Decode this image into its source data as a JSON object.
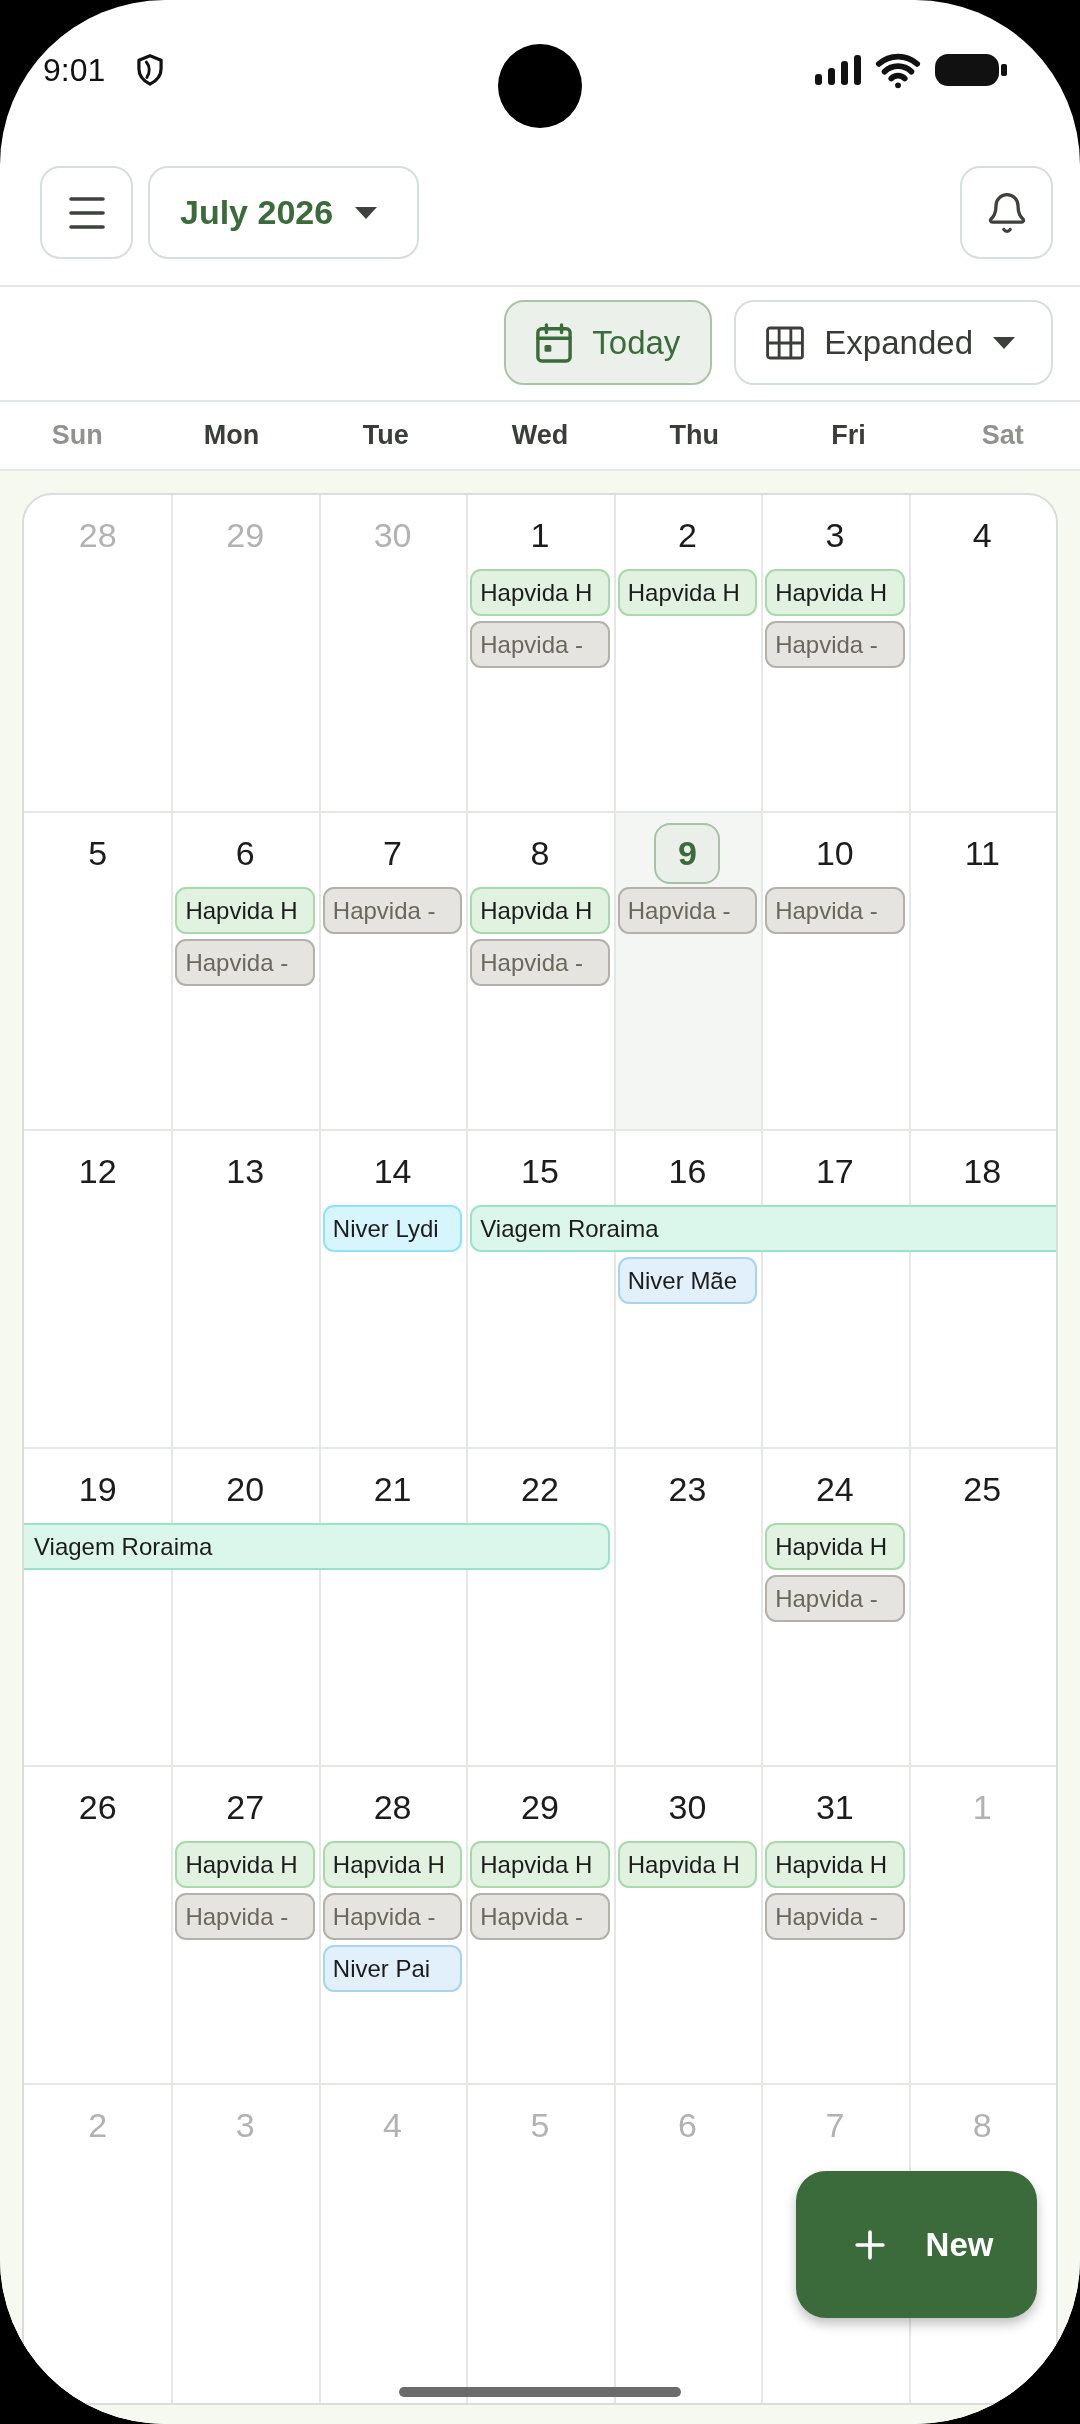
{
  "status_bar": {
    "time": "9:01"
  },
  "top_bar": {
    "month_button": {
      "label": "July 2026"
    }
  },
  "view_bar": {
    "today_button": {
      "label": "Today"
    },
    "view_select": {
      "label": "Expanded"
    }
  },
  "weekdays": [
    {
      "label": "Sun",
      "weekend": true
    },
    {
      "label": "Mon",
      "weekend": false
    },
    {
      "label": "Tue",
      "weekend": false
    },
    {
      "label": "Wed",
      "weekend": false
    },
    {
      "label": "Thu",
      "weekend": false
    },
    {
      "label": "Fri",
      "weekend": false
    },
    {
      "label": "Sat",
      "weekend": true
    }
  ],
  "weeks": [
    {
      "days": [
        {
          "label": "28",
          "in_month": false,
          "today": false
        },
        {
          "label": "29",
          "in_month": false,
          "today": false
        },
        {
          "label": "30",
          "in_month": false,
          "today": false
        },
        {
          "label": "1",
          "in_month": true,
          "today": false,
          "events": [
            {
              "kind": "single",
              "title": "Hapvida H",
              "color": "#a8d9aa"
            },
            {
              "kind": "single",
              "title": "Hapvida -",
              "color": "#b4b1aa"
            }
          ]
        },
        {
          "label": "2",
          "in_month": true,
          "today": false,
          "events": [
            {
              "kind": "single",
              "title": "Hapvida H",
              "color": "#a8d9aa"
            }
          ]
        },
        {
          "label": "3",
          "in_month": true,
          "today": false,
          "events": [
            {
              "kind": "single",
              "title": "Hapvida H",
              "color": "#a8d9aa"
            },
            {
              "kind": "single",
              "title": "Hapvida -",
              "color": "#b4b1aa"
            }
          ]
        },
        {
          "label": "4",
          "in_month": true,
          "today": false
        }
      ]
    },
    {
      "days": [
        {
          "label": "5",
          "in_month": true,
          "today": false
        },
        {
          "label": "6",
          "in_month": true,
          "today": false,
          "events": [
            {
              "kind": "single",
              "title": "Hapvida H",
              "color": "#a8d9aa"
            },
            {
              "kind": "single",
              "title": "Hapvida -",
              "color": "#b4b1aa"
            }
          ]
        },
        {
          "label": "7",
          "in_month": true,
          "today": false,
          "events": [
            {
              "kind": "single",
              "title": "Hapvida -",
              "color": "#b4b1aa"
            }
          ]
        },
        {
          "label": "8",
          "in_month": true,
          "today": false,
          "events": [
            {
              "kind": "single",
              "title": "Hapvida H",
              "color": "#a8d9aa"
            },
            {
              "kind": "single",
              "title": "Hapvida -",
              "color": "#b4b1aa"
            }
          ]
        },
        {
          "label": "9",
          "in_month": true,
          "today": true,
          "events": [
            {
              "kind": "single",
              "title": "Hapvida -",
              "color": "#b4b1aa"
            }
          ]
        },
        {
          "label": "10",
          "in_month": true,
          "today": false,
          "events": [
            {
              "kind": "single",
              "title": "Hapvida -",
              "color": "#b4b1aa"
            }
          ]
        },
        {
          "label": "11",
          "in_month": true,
          "today": false
        }
      ]
    },
    {
      "days": [
        {
          "label": "12",
          "in_month": true,
          "today": false
        },
        {
          "label": "13",
          "in_month": true,
          "today": false
        },
        {
          "label": "14",
          "in_month": true,
          "today": false,
          "events": [
            {
              "kind": "single",
              "title": "Niver Lydi",
              "color": "#8ee3fa"
            }
          ]
        },
        {
          "label": "15",
          "in_month": true,
          "today": false,
          "events": [
            {
              "kind": "start",
              "title": "Viagem Roraima",
              "color": "#99e4c6"
            }
          ]
        },
        {
          "label": "16",
          "in_month": true,
          "today": false,
          "events": [
            {
              "kind": "through"
            },
            {
              "kind": "single",
              "title": "Niver Mãe",
              "color": "#a8d4f0"
            }
          ]
        },
        {
          "label": "17",
          "in_month": true,
          "today": false,
          "events": [
            {
              "kind": "through"
            }
          ]
        },
        {
          "label": "18",
          "in_month": true,
          "today": false,
          "events": [
            {
              "kind": "through"
            }
          ]
        }
      ]
    },
    {
      "days": [
        {
          "label": "19",
          "in_month": true,
          "today": false,
          "events": [
            {
              "kind": "carry",
              "title": "Viagem Roraima",
              "color": "#99e4c6"
            }
          ]
        },
        {
          "label": "20",
          "in_month": true,
          "today": false,
          "events": [
            {
              "kind": "through"
            }
          ]
        },
        {
          "label": "21",
          "in_month": true,
          "today": false,
          "events": [
            {
              "kind": "through"
            }
          ]
        },
        {
          "label": "22",
          "in_month": true,
          "today": false,
          "events": [
            {
              "kind": "end"
            }
          ]
        },
        {
          "label": "23",
          "in_month": true,
          "today": false
        },
        {
          "label": "24",
          "in_month": true,
          "today": false,
          "events": [
            {
              "kind": "single",
              "title": "Hapvida H",
              "color": "#a8d9aa"
            },
            {
              "kind": "single",
              "title": "Hapvida -",
              "color": "#b4b1aa"
            }
          ]
        },
        {
          "label": "25",
          "in_month": true,
          "today": false
        }
      ]
    },
    {
      "days": [
        {
          "label": "26",
          "in_month": true,
          "today": false
        },
        {
          "label": "27",
          "in_month": true,
          "today": false,
          "events": [
            {
              "kind": "single",
              "title": "Hapvida H",
              "color": "#a8d9aa"
            },
            {
              "kind": "single",
              "title": "Hapvida -",
              "color": "#b4b1aa"
            }
          ]
        },
        {
          "label": "28",
          "in_month": true,
          "today": false,
          "events": [
            {
              "kind": "single",
              "title": "Hapvida H",
              "color": "#a8d9aa"
            },
            {
              "kind": "single",
              "title": "Hapvida -",
              "color": "#b4b1aa"
            },
            {
              "kind": "single",
              "title": "Niver Pai",
              "color": "#a8d4f0"
            }
          ]
        },
        {
          "label": "29",
          "in_month": true,
          "today": false,
          "events": [
            {
              "kind": "single",
              "title": "Hapvida H",
              "color": "#a8d9aa"
            },
            {
              "kind": "single",
              "title": "Hapvida -",
              "color": "#b4b1aa"
            }
          ]
        },
        {
          "label": "30",
          "in_month": true,
          "today": false,
          "events": [
            {
              "kind": "single",
              "title": "Hapvida H",
              "color": "#a8d9aa"
            }
          ]
        },
        {
          "label": "31",
          "in_month": true,
          "today": false,
          "events": [
            {
              "kind": "single",
              "title": "Hapvida H",
              "color": "#a8d9aa"
            },
            {
              "kind": "single",
              "title": "Hapvida -",
              "color": "#b4b1aa"
            }
          ]
        },
        {
          "label": "1",
          "in_month": false,
          "today": false
        }
      ]
    },
    {
      "days": [
        {
          "label": "2",
          "in_month": false,
          "today": false
        },
        {
          "label": "3",
          "in_month": false,
          "today": false
        },
        {
          "label": "4",
          "in_month": false,
          "today": false
        },
        {
          "label": "5",
          "in_month": false,
          "today": false
        },
        {
          "label": "6",
          "in_month": false,
          "today": false
        },
        {
          "label": "7",
          "in_month": false,
          "today": false
        },
        {
          "label": "8",
          "in_month": false,
          "today": false
        }
      ]
    }
  ],
  "fab": {
    "label": "New"
  }
}
